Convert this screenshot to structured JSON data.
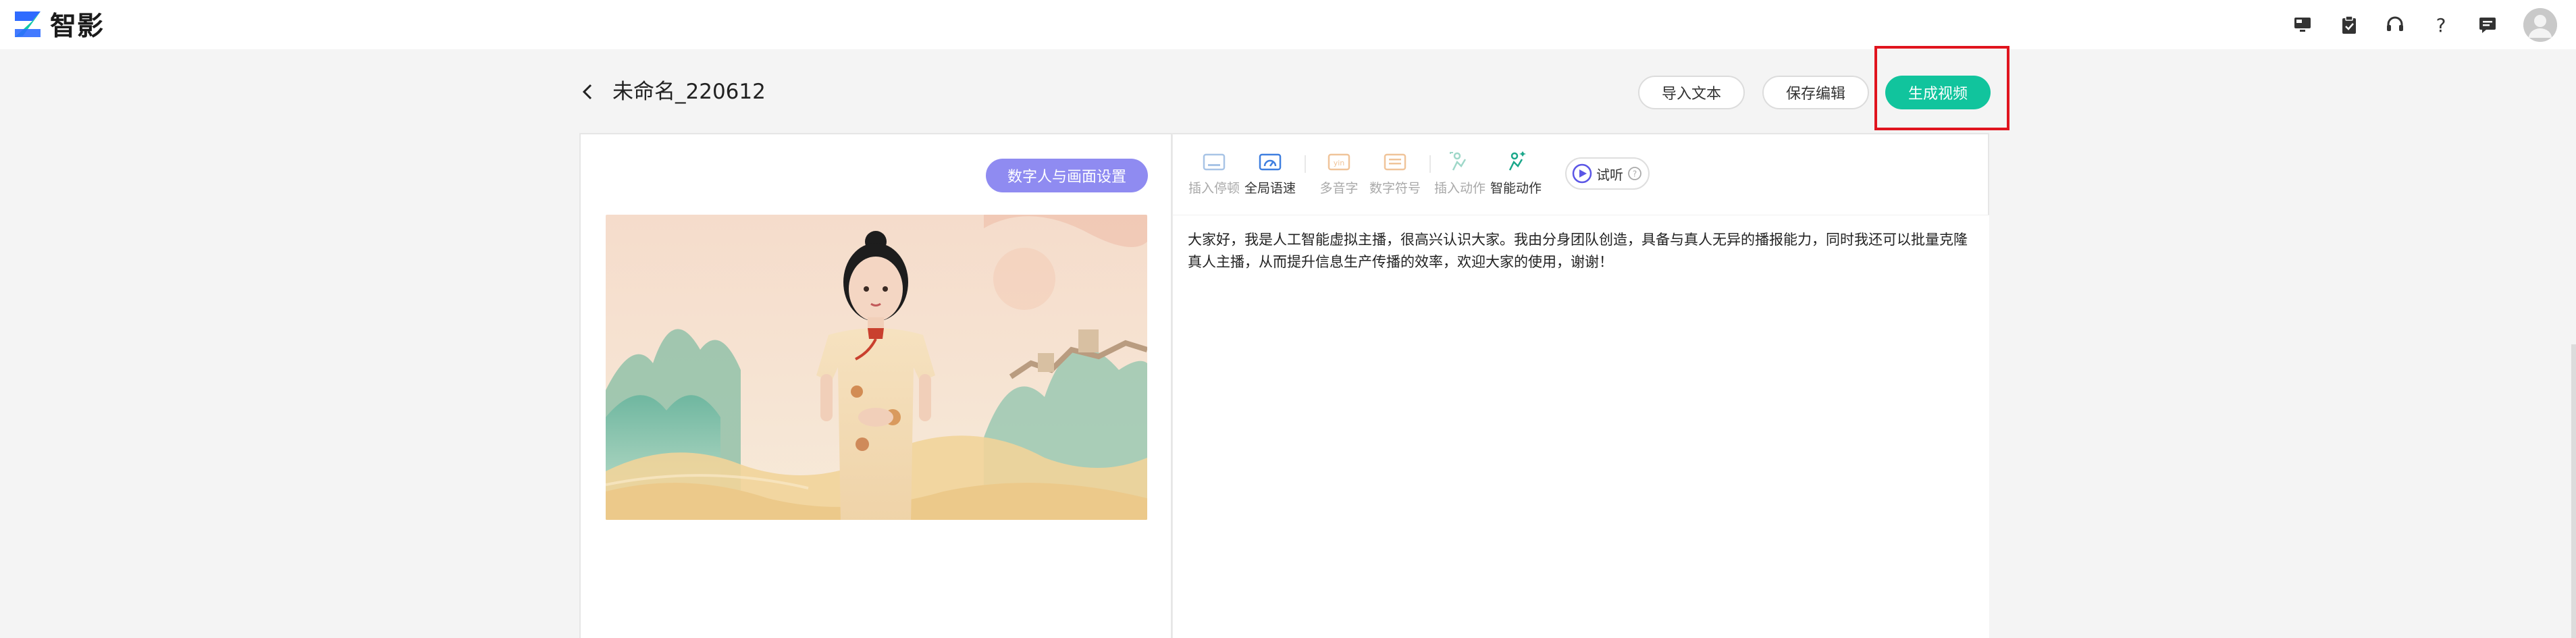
{
  "app": {
    "name": "智影",
    "brand_colors": {
      "logo_blue": "#2f6bff",
      "logo_teal": "#12c9a8"
    }
  },
  "top_icons": [
    "monitor-icon",
    "clipboard-check-icon",
    "headset-icon",
    "help-icon",
    "message-icon"
  ],
  "document": {
    "title": "未命名_220612"
  },
  "actions": {
    "import_text": "导入文本",
    "save_edit": "保存编辑",
    "generate_video": "生成视频"
  },
  "left_panel": {
    "settings_button": "数字人与画面设置"
  },
  "toolbar": {
    "items": [
      {
        "label": "插入停顿",
        "icon": "pause-insert-icon",
        "enabled": false
      },
      {
        "label": "全局语速",
        "icon": "speed-gauge-icon",
        "enabled": true
      },
      {
        "label": "多音字",
        "icon": "polyphone-icon",
        "enabled": false
      },
      {
        "label": "数字符号",
        "icon": "number-symbol-icon",
        "enabled": false
      },
      {
        "label": "插入动作",
        "icon": "insert-action-icon",
        "enabled": false
      },
      {
        "label": "智能动作",
        "icon": "smart-action-icon",
        "enabled": true
      }
    ],
    "audition_label": "试听"
  },
  "script_text": "大家好，我是人工智能虚拟主播，很高兴认识大家。我由分身团队创造，具备与真人无异的播报能力，同时我还可以批量克隆真人主播，从而提升信息生产传播的效率，欢迎大家的使用，谢谢！",
  "colors": {
    "primary": "#11c49d",
    "settings_button": "#8f8bf1",
    "highlight": "#e0141e"
  }
}
